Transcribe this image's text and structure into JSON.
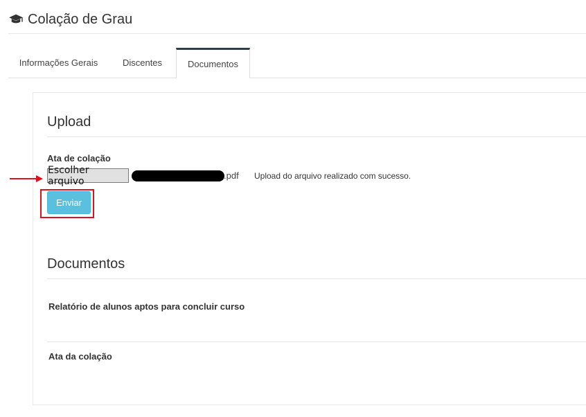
{
  "page": {
    "title": "Colação de Grau",
    "icon": "graduation-cap-icon"
  },
  "tabs": [
    {
      "label": "Informações Gerais",
      "active": false
    },
    {
      "label": "Discentes",
      "active": false
    },
    {
      "label": "Documentos",
      "active": true
    }
  ],
  "upload": {
    "heading": "Upload",
    "field_label": "Ata de colação",
    "choose_button": "Escolher arquivo",
    "file_extension": ".pdf",
    "status_message": "Upload do arquivo realizado com sucesso.",
    "submit_label": "Enviar"
  },
  "documents": {
    "heading": "Documentos",
    "items": [
      {
        "label": "Relatório de alunos aptos para concluir curso"
      },
      {
        "label": "Ata da colação"
      }
    ]
  },
  "colors": {
    "accent": "#5bc0de",
    "highlight": "#e0101f",
    "active_tab_border": "#2b3e50"
  }
}
